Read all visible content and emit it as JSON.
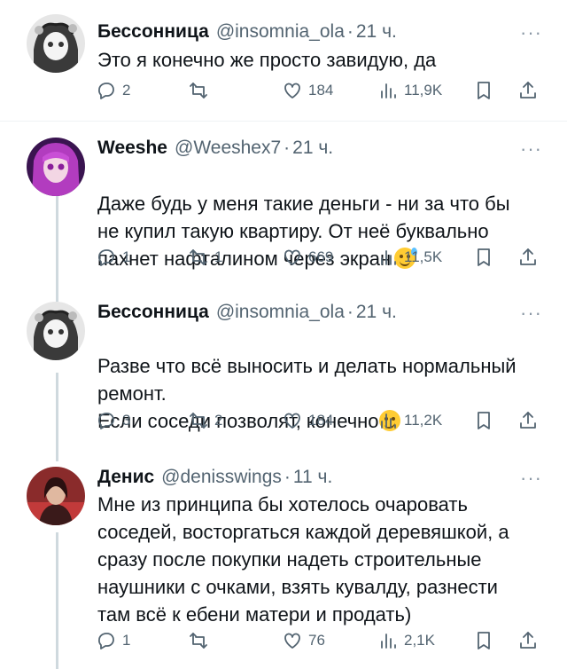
{
  "tweets": [
    {
      "name": "Бессонница",
      "handle": "@insomnia_ola",
      "sep": "·",
      "time": "21 ч.",
      "more": "···",
      "text": "Это я конечно же просто завидую, да",
      "emoji": "",
      "reply_count": "2",
      "retweet_count": "",
      "like_count": "184",
      "view_count": "11,9K",
      "avatar_icon": "anime-avatar-bw",
      "avatar_color": "#d9d9d9"
    },
    {
      "name": "Weeshe",
      "handle": "@Weeshex7",
      "sep": "·",
      "time": "21 ч.",
      "more": "···",
      "text": "Даже будь у меня такие деньги - ни за что бы\nне купил такую квартиру. От неё буквально\nпахнет нафталином через экран",
      "emoji": "grinning-sweat-emoji",
      "reply_count": "1",
      "retweet_count": "1",
      "like_count": "669",
      "view_count": "11,5K",
      "avatar_icon": "anime-avatar-purple",
      "avatar_color": "#7a2a8a"
    },
    {
      "name": "Бессонница",
      "handle": "@insomnia_ola",
      "sep": "·",
      "time": "21 ч.",
      "more": "···",
      "text": "Разве что всё выносить и делать нормальный\nремонт.\nЕсли соседи позволят, конечно",
      "emoji": "smirking-emoji",
      "reply_count": "3",
      "retweet_count": "2",
      "like_count": "184",
      "view_count": "11,2K",
      "avatar_icon": "anime-avatar-bw",
      "avatar_color": "#d9d9d9"
    },
    {
      "name": "Денис",
      "handle": "@denisswings",
      "sep": "·",
      "time": "11 ч.",
      "more": "···",
      "text": "Мне из принципа бы хотелось очаровать\nсоседей, восторгаться каждой деревяшкой, а\nсразу после покупки надеть строительные\nнаушники с очками, взять кувалду, разнести\nтам всё к ебени матери и продать)",
      "emoji": "",
      "reply_count": "1",
      "retweet_count": "",
      "like_count": "76",
      "view_count": "2,1K",
      "avatar_icon": "photo-avatar-red",
      "avatar_color": "#b33a3a"
    }
  ],
  "colors": {
    "text": "#0f1419",
    "secondary": "#536471",
    "thread_line": "#cfd9de",
    "divider": "#eff3f4"
  },
  "icons": [
    "reply-icon",
    "retweet-icon",
    "like-icon",
    "views-icon",
    "bookmark-icon",
    "share-icon"
  ]
}
